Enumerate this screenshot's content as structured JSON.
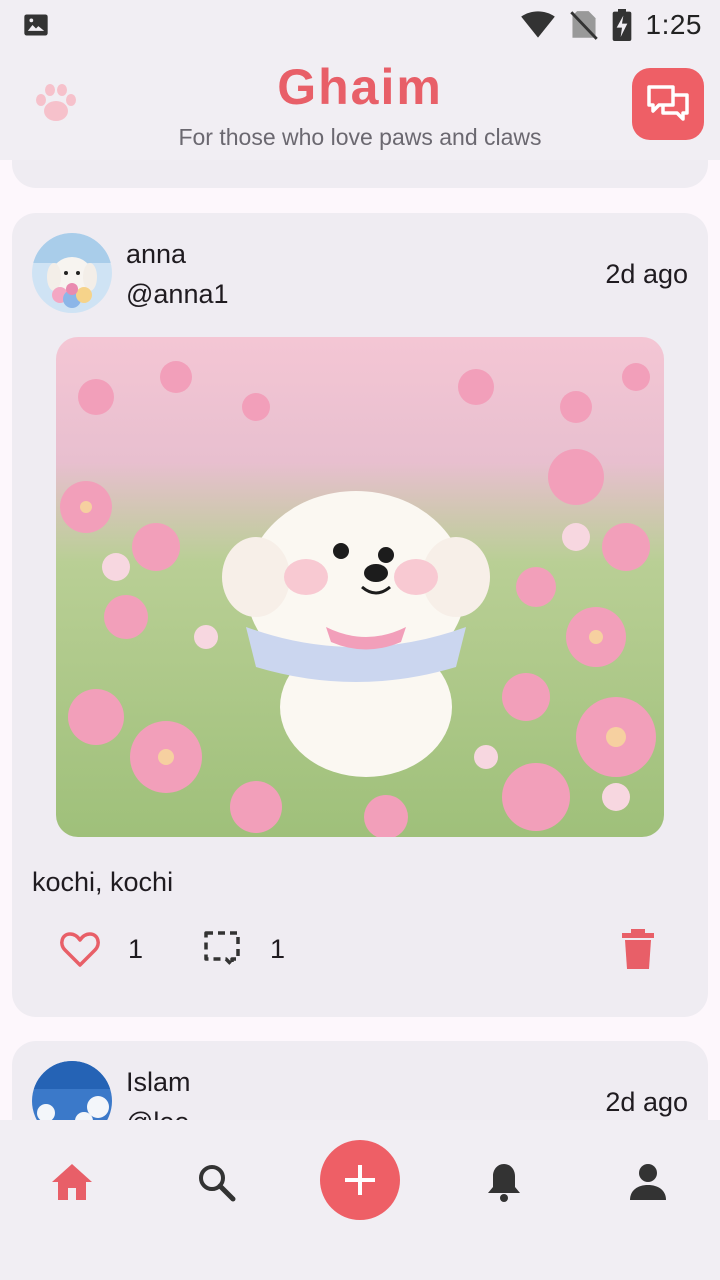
{
  "status_bar": {
    "time": "1:25"
  },
  "header": {
    "title": "Ghaim",
    "subtitle": "For those who love paws and claws"
  },
  "colors": {
    "accent": "#ee5f66",
    "title": "#e85f68",
    "card_bg": "#efecf2",
    "bar_bg": "#f1eef3"
  },
  "posts": [
    {
      "name": "anna",
      "handle": "@anna1",
      "time": "2d ago",
      "caption": "kochi, kochi",
      "likes": "1",
      "comments": "1"
    },
    {
      "name": "Islam",
      "handle": "@lee",
      "time": "2d ago"
    }
  ],
  "nav": {
    "items": [
      "home-icon",
      "search-icon",
      "add-icon",
      "bell-icon",
      "profile-icon"
    ],
    "active": "home-icon"
  }
}
